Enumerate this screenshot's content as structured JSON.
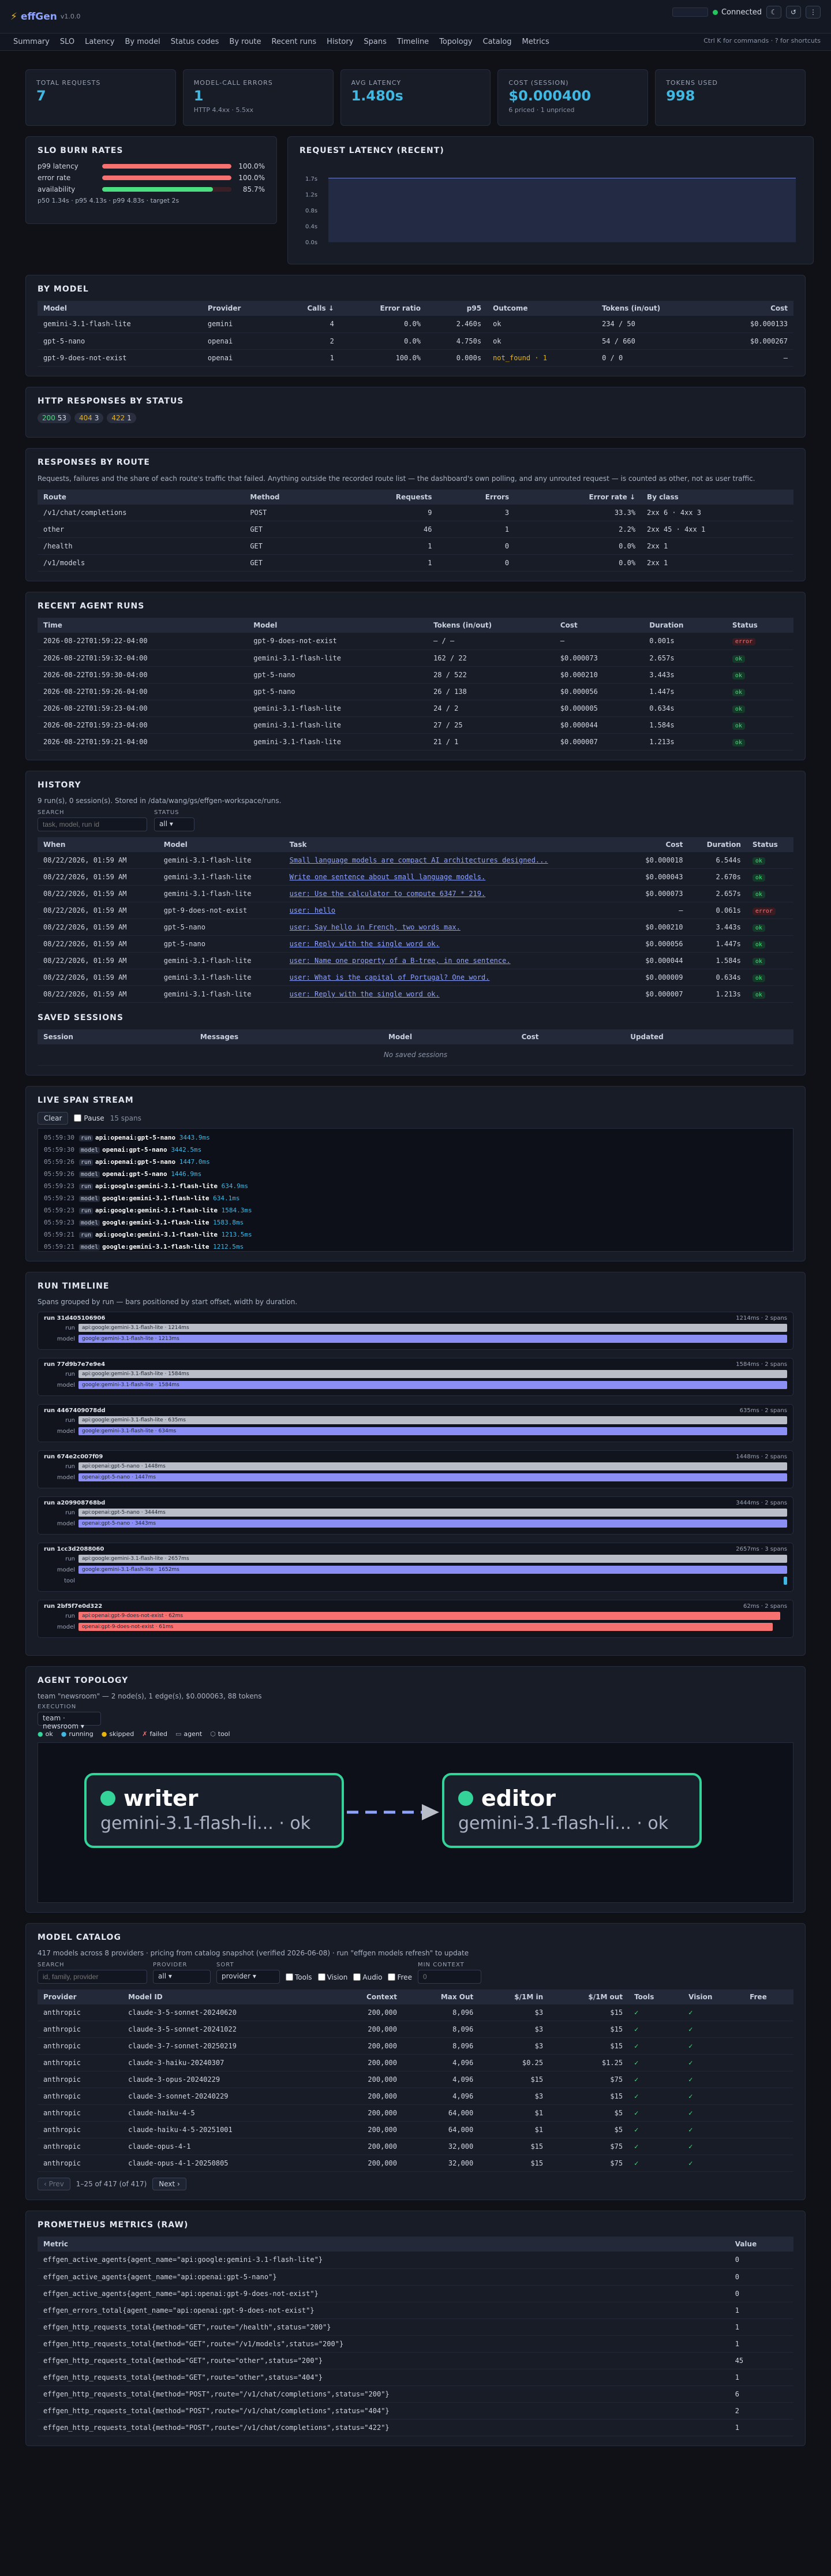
{
  "app": {
    "name": "effGen",
    "version": "v1.0.0",
    "status": "Connected",
    "hint": "Ctrl K for commands · ? for shortcuts"
  },
  "nav": [
    "Summary",
    "SLO",
    "Latency",
    "By model",
    "Status codes",
    "By route",
    "Recent runs",
    "History",
    "Spans",
    "Timeline",
    "Topology",
    "Catalog",
    "Metrics"
  ],
  "kpis": [
    {
      "label": "TOTAL REQUESTS",
      "value": "7",
      "note": ""
    },
    {
      "label": "MODEL-CALL ERRORS",
      "value": "1",
      "note": "HTTP 4.4xx · 5.5xx"
    },
    {
      "label": "AVG LATENCY",
      "value": "1.480s",
      "note": ""
    },
    {
      "label": "COST (SESSION)",
      "value": "$0.000400",
      "note": "6 priced · 1 unpriced"
    },
    {
      "label": "TOKENS USED",
      "value": "998",
      "note": ""
    }
  ],
  "slo": {
    "title": "SLO BURN RATES",
    "rows": [
      {
        "name": "p99 latency",
        "pct": "100.0%",
        "frac": 1.0,
        "color": "#f87171"
      },
      {
        "name": "error rate",
        "pct": "100.0%",
        "frac": 1.0,
        "color": "#f87171"
      },
      {
        "name": "availability",
        "pct": "85.7%",
        "frac": 0.857,
        "color": "#4ade80"
      }
    ],
    "foot": "p50 1.34s · p95 4.13s · p99 4.83s · target 2s"
  },
  "latency": {
    "title": "REQUEST LATENCY (RECENT)",
    "ticks": [
      "1.7s",
      "1.2s",
      "0.8s",
      "0.4s",
      "0.0s"
    ]
  },
  "by_model": {
    "title": "BY MODEL",
    "headers": [
      "Model",
      "Provider",
      "Calls ↓",
      "Error ratio",
      "p95",
      "Outcome",
      "Tokens (in/out)",
      "Cost"
    ],
    "rows": [
      [
        "gemini-3.1-flash-lite",
        "gemini",
        "4",
        "0.0%",
        "2.460s",
        "ok",
        "234 / 50",
        "$0.000133"
      ],
      [
        "gpt-5-nano",
        "openai",
        "2",
        "0.0%",
        "4.750s",
        "ok",
        "54 / 660",
        "$0.000267"
      ],
      [
        "gpt-9-does-not-exist",
        "openai",
        "1",
        "100.0%",
        "0.000s",
        "not_found · 1",
        "0 / 0",
        "–"
      ]
    ]
  },
  "http": {
    "title": "HTTP RESPONSES BY STATUS",
    "badges": [
      {
        "code": "200",
        "n": "53",
        "color": "#4ade80"
      },
      {
        "code": "404",
        "n": "3",
        "color": "#eab308"
      },
      {
        "code": "422",
        "n": "1",
        "color": "#eab308"
      }
    ]
  },
  "routes": {
    "title": "RESPONSES BY ROUTE",
    "desc": "Requests, failures and the share of each route's traffic that failed. Anything outside the recorded route list — the dashboard's own polling, and any unrouted request — is counted as other, not as user traffic.",
    "headers": [
      "Route",
      "Method",
      "Requests",
      "Errors",
      "Error rate ↓",
      "By class"
    ],
    "rows": [
      [
        "/v1/chat/completions",
        "POST",
        "9",
        "3",
        "33.3%",
        "2xx 6 · 4xx 3"
      ],
      [
        "other",
        "GET",
        "46",
        "1",
        "2.2%",
        "2xx 45 · 4xx 1"
      ],
      [
        "/health",
        "GET",
        "1",
        "0",
        "0.0%",
        "2xx 1"
      ],
      [
        "/v1/models",
        "GET",
        "1",
        "0",
        "0.0%",
        "2xx 1"
      ]
    ]
  },
  "recent": {
    "title": "RECENT AGENT RUNS",
    "headers": [
      "Time",
      "Model",
      "Tokens (in/out)",
      "Cost",
      "Duration",
      "Status"
    ],
    "rows": [
      [
        "2026-08-22T01:59:22-04:00",
        "gpt-9-does-not-exist",
        "– / –",
        "–",
        "0.001s",
        "error"
      ],
      [
        "2026-08-22T01:59:32-04:00",
        "gemini-3.1-flash-lite",
        "162 / 22",
        "$0.000073",
        "2.657s",
        "ok"
      ],
      [
        "2026-08-22T01:59:30-04:00",
        "gpt-5-nano",
        "28 / 522",
        "$0.000210",
        "3.443s",
        "ok"
      ],
      [
        "2026-08-22T01:59:26-04:00",
        "gpt-5-nano",
        "26 / 138",
        "$0.000056",
        "1.447s",
        "ok"
      ],
      [
        "2026-08-22T01:59:23-04:00",
        "gemini-3.1-flash-lite",
        "24 / 2",
        "$0.000005",
        "0.634s",
        "ok"
      ],
      [
        "2026-08-22T01:59:23-04:00",
        "gemini-3.1-flash-lite",
        "27 / 25",
        "$0.000044",
        "1.584s",
        "ok"
      ],
      [
        "2026-08-22T01:59:21-04:00",
        "gemini-3.1-flash-lite",
        "21 / 1",
        "$0.000007",
        "1.213s",
        "ok"
      ]
    ]
  },
  "history": {
    "title": "HISTORY",
    "desc": "9 run(s), 0 session(s). Stored in /data/wang/gs/effgen-workspace/runs.",
    "search_label": "SEARCH",
    "search_placeholder": "task, model, run id",
    "status_label": "STATUS",
    "status_value": "all",
    "headers": [
      "When",
      "Model",
      "Task",
      "Cost",
      "Duration",
      "Status"
    ],
    "rows": [
      [
        "08/22/2026, 01:59 AM",
        "gemini-3.1-flash-lite",
        "Small language models are compact AI architectures designed...",
        "$0.000018",
        "6.544s",
        "ok"
      ],
      [
        "08/22/2026, 01:59 AM",
        "gemini-3.1-flash-lite",
        "Write one sentence about small language models.",
        "$0.000043",
        "2.670s",
        "ok"
      ],
      [
        "08/22/2026, 01:59 AM",
        "gemini-3.1-flash-lite",
        "user: Use the calculator to compute 6347 * 219.",
        "$0.000073",
        "2.657s",
        "ok"
      ],
      [
        "08/22/2026, 01:59 AM",
        "gpt-9-does-not-exist",
        "user: hello",
        "–",
        "0.061s",
        "error"
      ],
      [
        "08/22/2026, 01:59 AM",
        "gpt-5-nano",
        "user: Say hello in French, two words max.",
        "$0.000210",
        "3.443s",
        "ok"
      ],
      [
        "08/22/2026, 01:59 AM",
        "gpt-5-nano",
        "user: Reply with the single word ok.",
        "$0.000056",
        "1.447s",
        "ok"
      ],
      [
        "08/22/2026, 01:59 AM",
        "gemini-3.1-flash-lite",
        "user: Name one property of a B-tree, in one sentence.",
        "$0.000044",
        "1.584s",
        "ok"
      ],
      [
        "08/22/2026, 01:59 AM",
        "gemini-3.1-flash-lite",
        "user: What is the capital of Portugal? One word.",
        "$0.000009",
        "0.634s",
        "ok"
      ],
      [
        "08/22/2026, 01:59 AM",
        "gemini-3.1-flash-lite",
        "user: Reply with the single word ok.",
        "$0.000007",
        "1.213s",
        "ok"
      ]
    ],
    "sessions_title": "SAVED SESSIONS",
    "sessions_headers": [
      "Session",
      "Messages",
      "Model",
      "Cost",
      "Updated"
    ],
    "sessions_empty": "No saved sessions"
  },
  "stream": {
    "title": "LIVE SPAN STREAM",
    "clear": "Clear",
    "pause": "Pause",
    "count": "15 spans",
    "lines": [
      [
        "05:59:30",
        "run",
        "api:openai:gpt-5-nano",
        "3443.9ms"
      ],
      [
        "05:59:30",
        "model",
        "openai:gpt-5-nano",
        "3442.5ms"
      ],
      [
        "05:59:26",
        "run",
        "api:openai:gpt-5-nano",
        "1447.0ms"
      ],
      [
        "05:59:26",
        "model",
        "openai:gpt-5-nano",
        "1446.9ms"
      ],
      [
        "05:59:23",
        "run",
        "api:google:gemini-3.1-flash-lite",
        "634.9ms"
      ],
      [
        "05:59:23",
        "model",
        "google:gemini-3.1-flash-lite",
        "634.1ms"
      ],
      [
        "05:59:23",
        "run",
        "api:google:gemini-3.1-flash-lite",
        "1584.3ms"
      ],
      [
        "05:59:23",
        "model",
        "google:gemini-3.1-flash-lite",
        "1583.8ms"
      ],
      [
        "05:59:21",
        "run",
        "api:google:gemini-3.1-flash-lite",
        "1213.5ms"
      ],
      [
        "05:59:21",
        "model",
        "google:gemini-3.1-flash-lite",
        "1212.5ms"
      ]
    ]
  },
  "timeline": {
    "title": "RUN TIMELINE",
    "desc": "Spans grouped by run — bars positioned by start offset, width by duration.",
    "runs": [
      {
        "id": "run 31d405106906",
        "meta": "1214ms · 2 spans",
        "rows": [
          [
            "run",
            "api:google:gemini-3.1-flash-lite · 1214ms",
            0,
            1,
            "#b8bdc8"
          ],
          [
            "model",
            "google:gemini-3.1-flash-lite · 1213ms",
            0,
            1,
            "#8b8ff5"
          ]
        ]
      },
      {
        "id": "run 77d9b7e7e9e4",
        "meta": "1584ms · 2 spans",
        "rows": [
          [
            "run",
            "api:google:gemini-3.1-flash-lite · 1584ms",
            0,
            1,
            "#b8bdc8"
          ],
          [
            "model",
            "google:gemini-3.1-flash-lite · 1584ms",
            0,
            1,
            "#8b8ff5"
          ]
        ]
      },
      {
        "id": "run 4467409078dd",
        "meta": "635ms · 2 spans",
        "rows": [
          [
            "run",
            "api:google:gemini-3.1-flash-lite · 635ms",
            0,
            1,
            "#b8bdc8"
          ],
          [
            "model",
            "google:gemini-3.1-flash-lite · 634ms",
            0,
            1,
            "#8b8ff5"
          ]
        ]
      },
      {
        "id": "run 674e2c007f09",
        "meta": "1448ms · 2 spans",
        "rows": [
          [
            "run",
            "api:openai:gpt-5-nano · 1448ms",
            0,
            1,
            "#b8bdc8"
          ],
          [
            "model",
            "openai:gpt-5-nano · 1447ms",
            0,
            1,
            "#8b8ff5"
          ]
        ]
      },
      {
        "id": "run a209908768bd",
        "meta": "3444ms · 2 spans",
        "rows": [
          [
            "run",
            "api:openai:gpt-5-nano · 3444ms",
            0,
            1,
            "#b8bdc8"
          ],
          [
            "model",
            "openai:gpt-5-nano · 3443ms",
            0,
            1,
            "#8b8ff5"
          ]
        ]
      },
      {
        "id": "run 1cc3d2088060",
        "meta": "2657ms · 3 spans",
        "rows": [
          [
            "run",
            "api:google:gemini-3.1-flash-lite · 2657ms",
            0,
            1,
            "#b8bdc8"
          ],
          [
            "model",
            "google:gemini-3.1-flash-lite · 1652ms",
            0,
            1,
            "#8b8ff5"
          ],
          [
            "tool",
            "",
            0.995,
            0.005,
            "#3fb9e4"
          ]
        ]
      },
      {
        "id": "run 2bf5f7e0d322",
        "meta": "62ms · 2 spans",
        "rows": [
          [
            "run",
            "api:openai:gpt-9-does-not-exist · 62ms",
            0,
            0.99,
            "#f87171"
          ],
          [
            "model",
            "openai:gpt-9-does-not-exist · 61ms",
            0,
            0.98,
            "#f87171"
          ]
        ]
      }
    ]
  },
  "topology": {
    "title": "AGENT TOPOLOGY",
    "desc": "team \"newsroom\" — 2 node(s), 1 edge(s), $0.000063, 88 tokens",
    "exec_label": "EXECUTION",
    "exec_value": "team · newsroom",
    "legend": [
      "ok",
      "running",
      "skipped",
      "failed",
      "agent",
      "tool"
    ],
    "nodes": [
      {
        "name": "writer",
        "sub": "gemini-3.1-flash-li... · ok"
      },
      {
        "name": "editor",
        "sub": "gemini-3.1-flash-li... · ok"
      }
    ]
  },
  "catalog": {
    "title": "MODEL CATALOG",
    "desc": "417 models across 8 providers · pricing from catalog snapshot (verified 2026-06-08) · run \"effgen models refresh\" to update",
    "search_label": "SEARCH",
    "search_placeholder": "id, family, provider",
    "provider_label": "PROVIDER",
    "provider_value": "all",
    "sort_label": "SORT",
    "sort_value": "provider",
    "checks": [
      "Tools",
      "Vision",
      "Audio",
      "Free"
    ],
    "minctx_label": "MIN CONTEXT",
    "minctx_placeholder": "0",
    "headers": [
      "Provider",
      "Model ID",
      "Context",
      "Max Out",
      "$/1M in",
      "$/1M out",
      "Tools",
      "Vision",
      "Free"
    ],
    "rows": [
      [
        "anthropic",
        "claude-3-5-sonnet-20240620",
        "200,000",
        "8,096",
        "$3",
        "$15",
        "✓",
        "✓",
        ""
      ],
      [
        "anthropic",
        "claude-3-5-sonnet-20241022",
        "200,000",
        "8,096",
        "$3",
        "$15",
        "✓",
        "✓",
        ""
      ],
      [
        "anthropic",
        "claude-3-7-sonnet-20250219",
        "200,000",
        "8,096",
        "$3",
        "$15",
        "✓",
        "✓",
        ""
      ],
      [
        "anthropic",
        "claude-3-haiku-20240307",
        "200,000",
        "4,096",
        "$0.25",
        "$1.25",
        "✓",
        "✓",
        ""
      ],
      [
        "anthropic",
        "claude-3-opus-20240229",
        "200,000",
        "4,096",
        "$15",
        "$75",
        "✓",
        "✓",
        ""
      ],
      [
        "anthropic",
        "claude-3-sonnet-20240229",
        "200,000",
        "4,096",
        "$3",
        "$15",
        "✓",
        "✓",
        ""
      ],
      [
        "anthropic",
        "claude-haiku-4-5",
        "200,000",
        "64,000",
        "$1",
        "$5",
        "✓",
        "✓",
        ""
      ],
      [
        "anthropic",
        "claude-haiku-4-5-20251001",
        "200,000",
        "64,000",
        "$1",
        "$5",
        "✓",
        "✓",
        ""
      ],
      [
        "anthropic",
        "claude-opus-4-1",
        "200,000",
        "32,000",
        "$15",
        "$75",
        "✓",
        "✓",
        ""
      ],
      [
        "anthropic",
        "claude-opus-4-1-20250805",
        "200,000",
        "32,000",
        "$15",
        "$75",
        "✓",
        "✓",
        ""
      ]
    ],
    "prev": "‹ Prev",
    "page": "1–25 of 417 (of 417)",
    "next": "Next ›"
  },
  "prom": {
    "title": "PROMETHEUS METRICS (RAW)",
    "headers": [
      "Metric",
      "Value"
    ],
    "rows": [
      [
        "effgen_active_agents{agent_name=\"api:google:gemini-3.1-flash-lite\"}",
        "0"
      ],
      [
        "effgen_active_agents{agent_name=\"api:openai:gpt-5-nano\"}",
        "0"
      ],
      [
        "effgen_active_agents{agent_name=\"api:openai:gpt-9-does-not-exist\"}",
        "0"
      ],
      [
        "effgen_errors_total{agent_name=\"api:openai:gpt-9-does-not-exist\"}",
        "1"
      ],
      [
        "effgen_http_requests_total{method=\"GET\",route=\"/health\",status=\"200\"}",
        "1"
      ],
      [
        "effgen_http_requests_total{method=\"GET\",route=\"/v1/models\",status=\"200\"}",
        "1"
      ],
      [
        "effgen_http_requests_total{method=\"GET\",route=\"other\",status=\"200\"}",
        "45"
      ],
      [
        "effgen_http_requests_total{method=\"GET\",route=\"other\",status=\"404\"}",
        "1"
      ],
      [
        "effgen_http_requests_total{method=\"POST\",route=\"/v1/chat/completions\",status=\"200\"}",
        "6"
      ],
      [
        "effgen_http_requests_total{method=\"POST\",route=\"/v1/chat/completions\",status=\"404\"}",
        "2"
      ],
      [
        "effgen_http_requests_total{method=\"POST\",route=\"/v1/chat/completions\",status=\"422\"}",
        "1"
      ]
    ]
  }
}
